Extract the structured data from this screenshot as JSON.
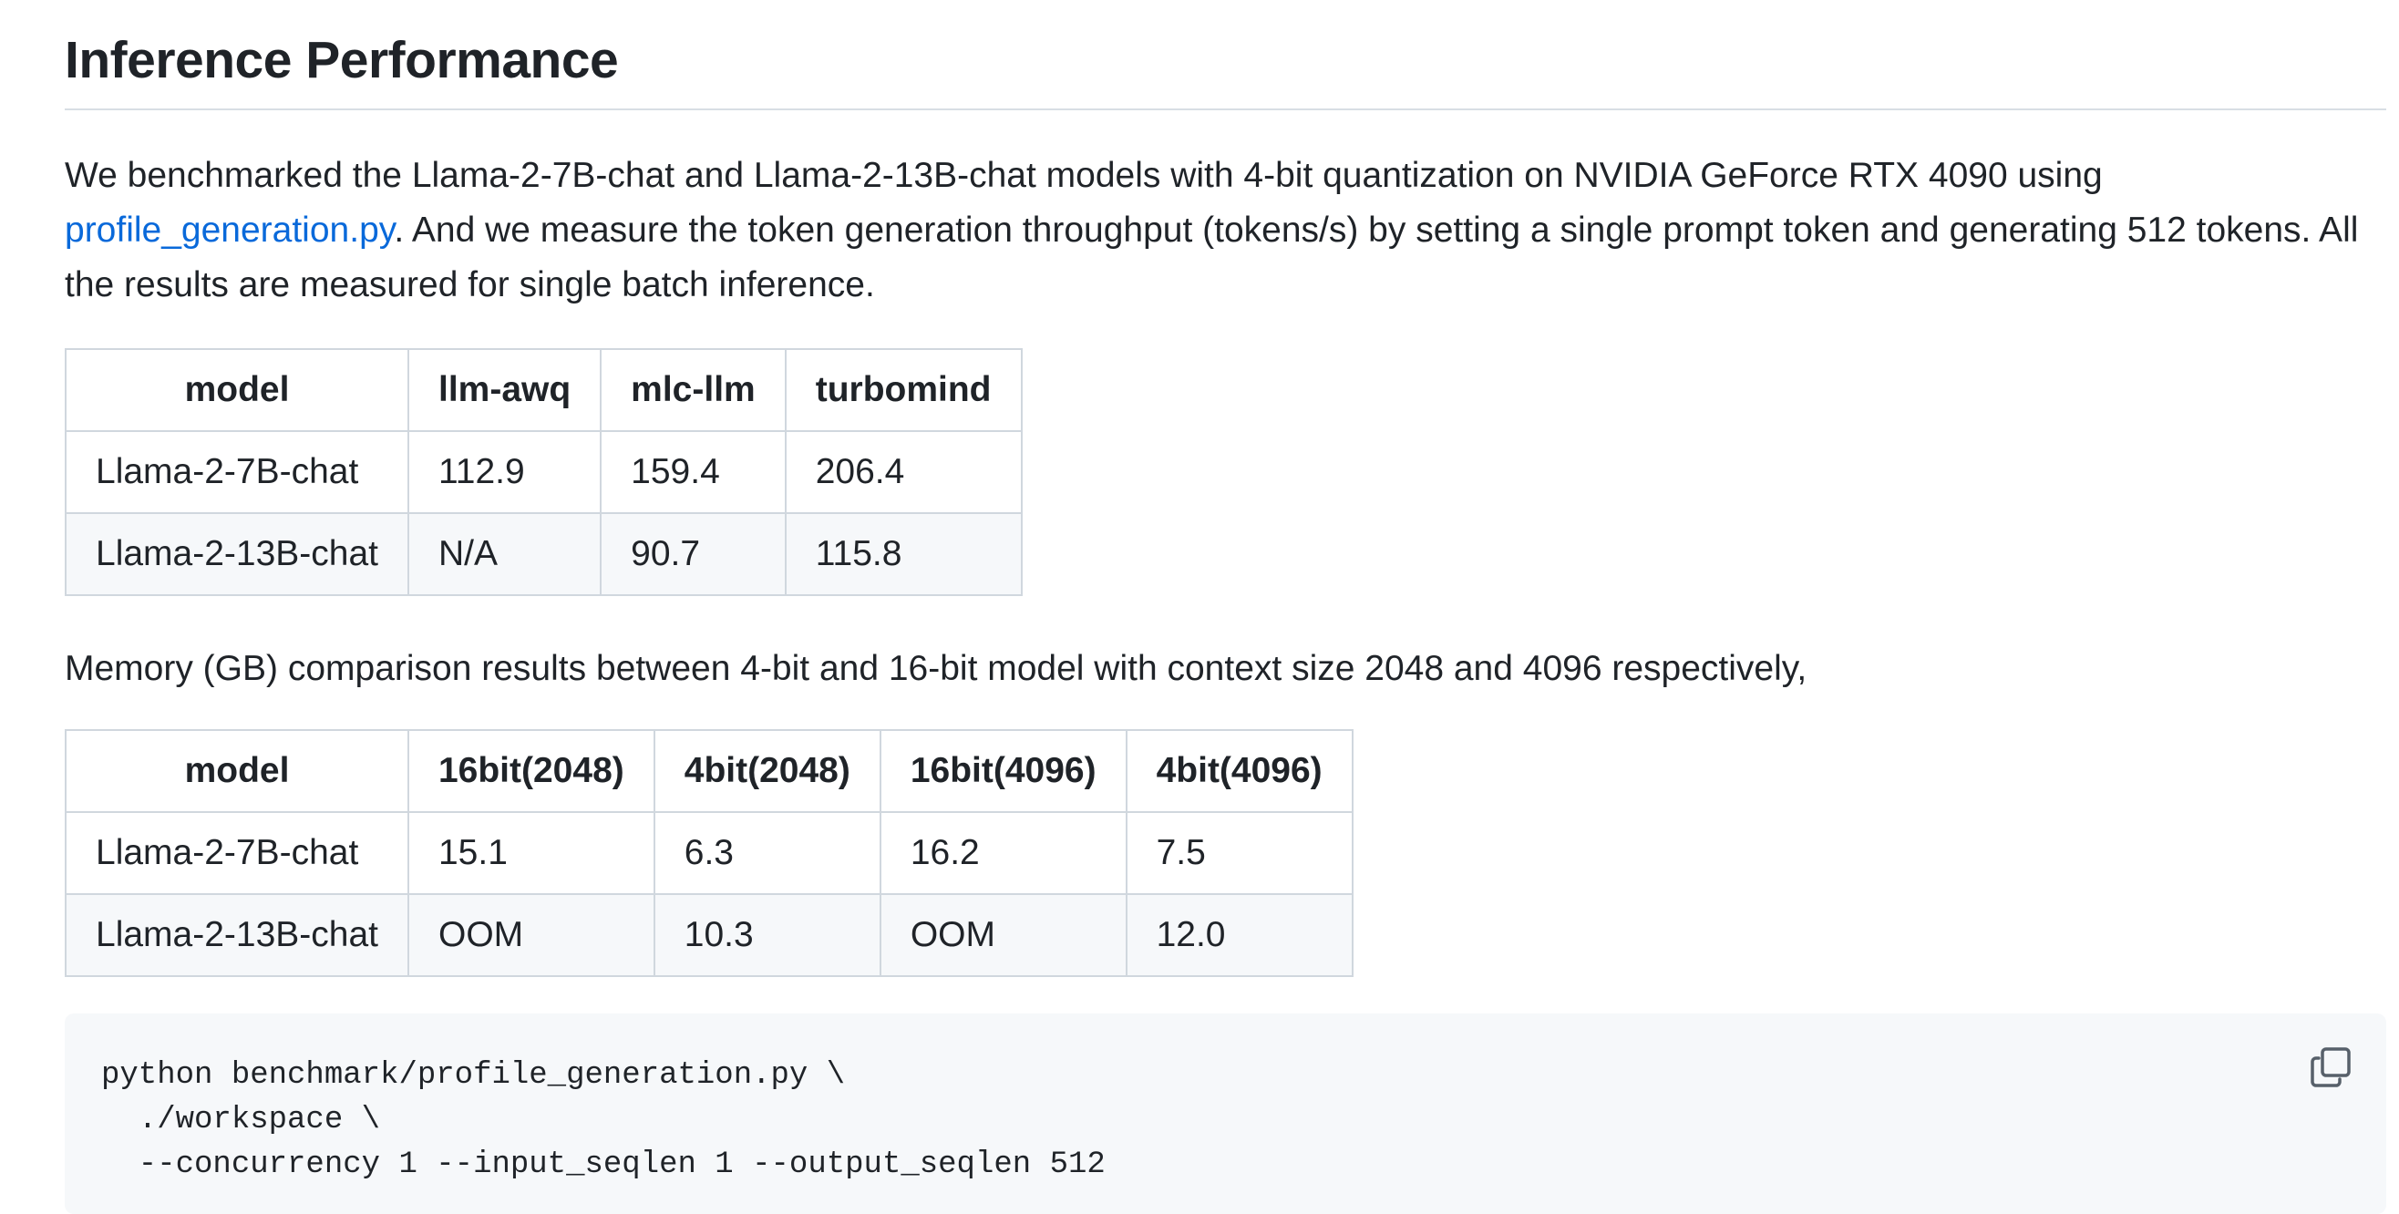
{
  "heading": "Inference Performance",
  "intro": {
    "text_before": "We benchmarked the Llama-2-7B-chat and Llama-2-13B-chat models with 4-bit quantization on NVIDIA GeForce RTX 4090 using ",
    "link_text": "profile_generation.py",
    "text_after": ". And we measure the token generation throughput (tokens/s) by setting a single prompt token and generating 512 tokens. All the results are measured for single batch inference."
  },
  "throughput_table": {
    "headers": [
      "model",
      "llm-awq",
      "mlc-llm",
      "turbomind"
    ],
    "rows": [
      [
        "Llama-2-7B-chat",
        "112.9",
        "159.4",
        "206.4"
      ],
      [
        "Llama-2-13B-chat",
        "N/A",
        "90.7",
        "115.8"
      ]
    ]
  },
  "memory_intro": "Memory (GB) comparison results between 4-bit and 16-bit model with context size 2048 and 4096 respectively,",
  "memory_table": {
    "headers": [
      "model",
      "16bit(2048)",
      "4bit(2048)",
      "16bit(4096)",
      "4bit(4096)"
    ],
    "rows": [
      [
        "Llama-2-7B-chat",
        "15.1",
        "6.3",
        "16.2",
        "7.5"
      ],
      [
        "Llama-2-13B-chat",
        "OOM",
        "10.3",
        "OOM",
        "12.0"
      ]
    ]
  },
  "code": {
    "text": "python benchmark/profile_generation.py \\\n  ./workspace \\\n  --concurrency 1 --input_seqlen 1 --output_seqlen 512",
    "copy_icon": "copy-icon"
  },
  "colors": {
    "link": "#0969da",
    "border": "#d0d7de",
    "code_bg": "#f6f8fa"
  }
}
